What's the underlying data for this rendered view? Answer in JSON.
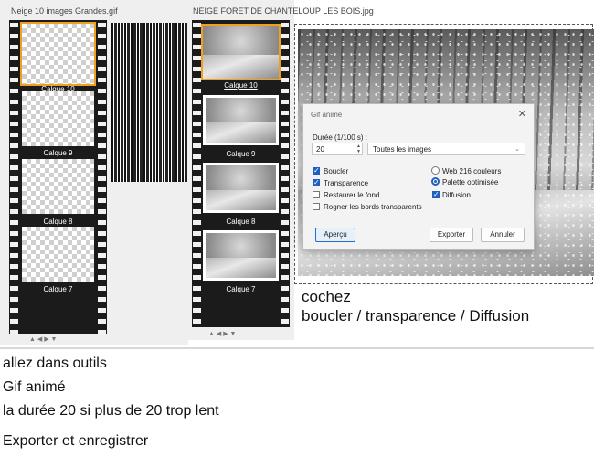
{
  "left_panel": {
    "title": "Neige 10 images Grandes.gif",
    "frames": [
      {
        "label": "Calque 10",
        "selected": true
      },
      {
        "label": "Calque 9",
        "selected": false
      },
      {
        "label": "Calque 8",
        "selected": false
      },
      {
        "label": "Calque 7",
        "selected": false
      }
    ],
    "arrows": "▲  ◀  ▶  ▼"
  },
  "middle_panel": {
    "title": "NEIGE FORET DE CHANTELOUP LES BOIS.jpg",
    "frames": [
      {
        "label": "Calque 10",
        "selected": true
      },
      {
        "label": "Calque 9",
        "selected": false
      },
      {
        "label": "Calque 8",
        "selected": false
      },
      {
        "label": "Calque 7",
        "selected": false
      }
    ],
    "arrows": "▲  ◀  ▶  ▼"
  },
  "dialog": {
    "title": "Gif animé",
    "duration_label": "Durée (1/100 s) :",
    "duration_value": "20",
    "images_select": "Toutes les images",
    "checkboxes": [
      {
        "label": "Boucler",
        "checked": true
      },
      {
        "label": "Transparence",
        "checked": true
      },
      {
        "label": "Restaurer le fond",
        "checked": false
      },
      {
        "label": "Rogner les bords transparents",
        "checked": false
      }
    ],
    "radios": [
      {
        "label": "Web 216 couleurs",
        "selected": false
      },
      {
        "label": "Palette optimisée",
        "selected": true
      }
    ],
    "diffusion": {
      "label": "Diffusion",
      "checked": true
    },
    "buttons": {
      "preview": "Aperçu",
      "export": "Exporter",
      "cancel": "Annuler"
    }
  },
  "caption": {
    "line1": "cochez",
    "line2": "boucler / transparence / Diffusion"
  },
  "notes": [
    "allez dans outils",
    "Gif animé",
    "la durée 20 si plus de 20 trop lent",
    "Exporter et enregistrer"
  ],
  "colors": {
    "accent": "#1f5fbf",
    "selection": "#f0a020",
    "film": "#1b1b1b"
  }
}
